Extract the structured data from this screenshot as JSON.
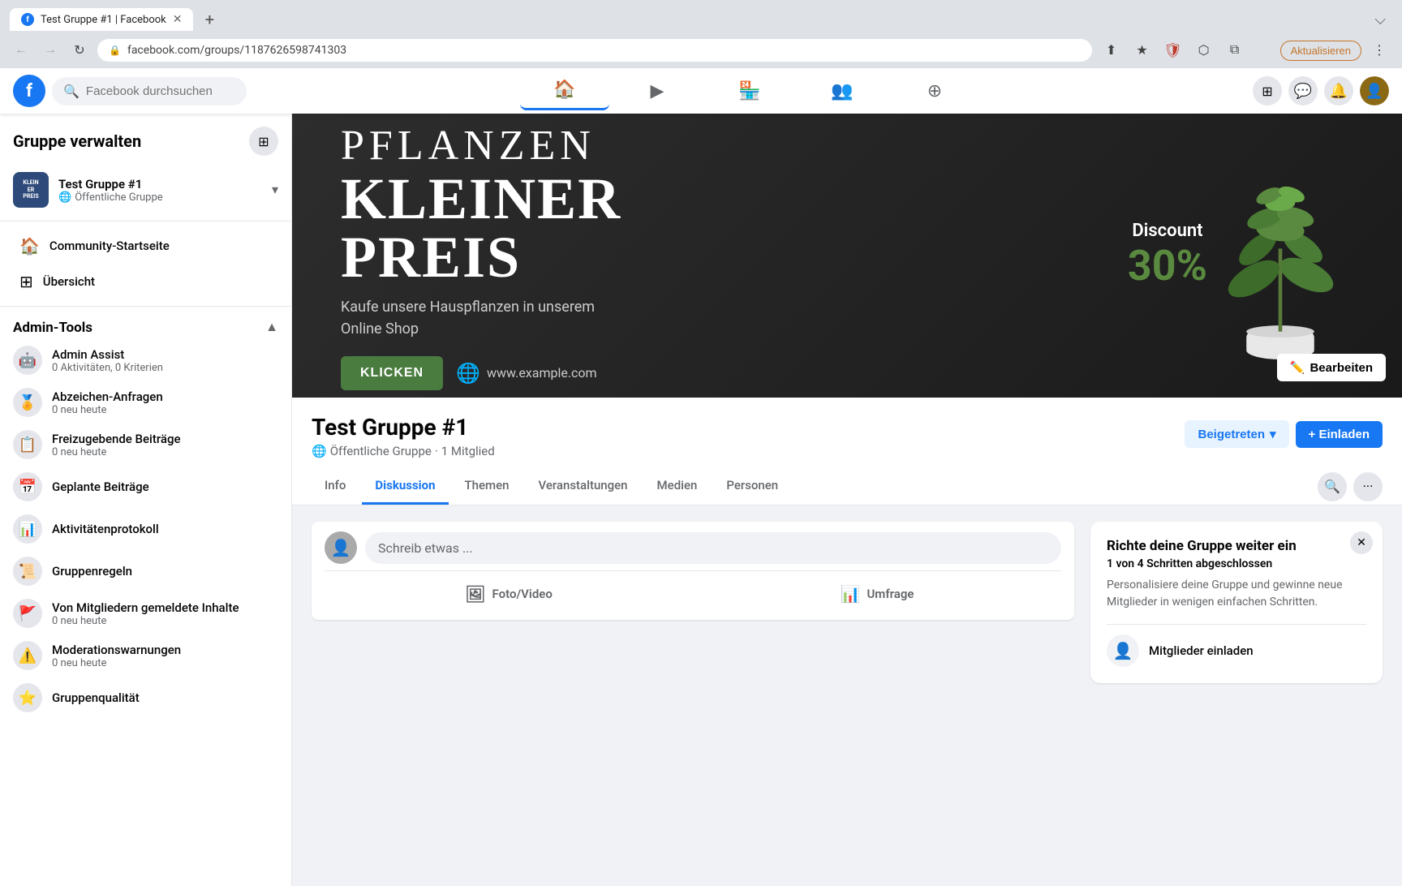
{
  "browser": {
    "tab_title": "Test Gruppe #1 | Facebook",
    "url": "facebook.com/groups/1187626598741303",
    "new_tab_icon": "+",
    "aktualisieren_label": "Aktualisieren"
  },
  "header": {
    "logo_letter": "f",
    "search_placeholder": "Facebook durchsuchen",
    "nav_items": [
      {
        "icon": "🏠",
        "label": "home"
      },
      {
        "icon": "▶",
        "label": "watch"
      },
      {
        "icon": "🏪",
        "label": "marketplace"
      },
      {
        "icon": "👥",
        "label": "groups"
      },
      {
        "icon": "⊕",
        "label": "gaming"
      }
    ]
  },
  "sidebar": {
    "title": "Gruppe verwalten",
    "group_name": "Test Gruppe #1",
    "group_type": "Öffentliche Gruppe",
    "nav_items": [
      {
        "label": "Community-Startseite",
        "icon": "🏠"
      },
      {
        "label": "Übersicht",
        "icon": "⊞"
      }
    ],
    "admin_section_title": "Admin-Tools",
    "admin_items": [
      {
        "name": "Admin Assist",
        "sub": "0 Aktivitäten, 0 Kriterien",
        "icon": "🤖"
      },
      {
        "name": "Abzeichen-Anfragen",
        "sub": "0 neu heute",
        "icon": "🏅"
      },
      {
        "name": "Freizugebende Beiträge",
        "sub": "0 neu heute",
        "icon": "📋"
      },
      {
        "name": "Geplante Beiträge",
        "sub": "",
        "icon": "📅"
      },
      {
        "name": "Aktivitätenprotokoll",
        "sub": "",
        "icon": "📊"
      },
      {
        "name": "Gruppenregeln",
        "sub": "",
        "icon": "📜"
      },
      {
        "name": "Von Mitgliedern gemeldete Inhalte",
        "sub": "0 neu heute",
        "icon": "🚩"
      },
      {
        "name": "Moderationswarnungen",
        "sub": "0 neu heute",
        "icon": "⚠️"
      },
      {
        "name": "Gruppenqualität",
        "sub": "",
        "icon": "⭐"
      }
    ]
  },
  "cover": {
    "pflanzen": "PFLANZEN",
    "kleiner": "KLEINER",
    "preis": "PREIS",
    "subtitle_line1": "Kaufe unsere Hauspflanzen in unserem",
    "subtitle_line2": "Online Shop",
    "klicken_label": "KLICKEN",
    "url_text": "www.example.com",
    "discount_label": "Discount",
    "discount_pct": "30%",
    "edit_btn": "Bearbeiten"
  },
  "group": {
    "title": "Test Gruppe #1",
    "type": "Öffentliche Gruppe",
    "members": "1 Mitglied",
    "beigetreten_label": "Beigetreten",
    "einladen_label": "+ Einladen"
  },
  "tabs": [
    {
      "label": "Info",
      "active": false
    },
    {
      "label": "Diskussion",
      "active": true
    },
    {
      "label": "Themen",
      "active": false
    },
    {
      "label": "Veranstaltungen",
      "active": false
    },
    {
      "label": "Medien",
      "active": false
    },
    {
      "label": "Personen",
      "active": false
    }
  ],
  "post_box": {
    "placeholder": "Schreib etwas ...",
    "actions": [
      {
        "label": "Foto/Video",
        "icon": "🖼"
      },
      {
        "label": "Umfrage",
        "icon": "📊"
      }
    ]
  },
  "setup_card": {
    "title": "Richte deine Gruppe weiter ein",
    "progress_text": "1 von 4",
    "progress_suffix": "Schritten abgeschlossen",
    "description": "Personalisiere deine Gruppe und gewinne neue Mitglieder in wenigen einfachen Schritten.",
    "item_label": "Mitglieder einladen",
    "item_icon": "👤"
  }
}
